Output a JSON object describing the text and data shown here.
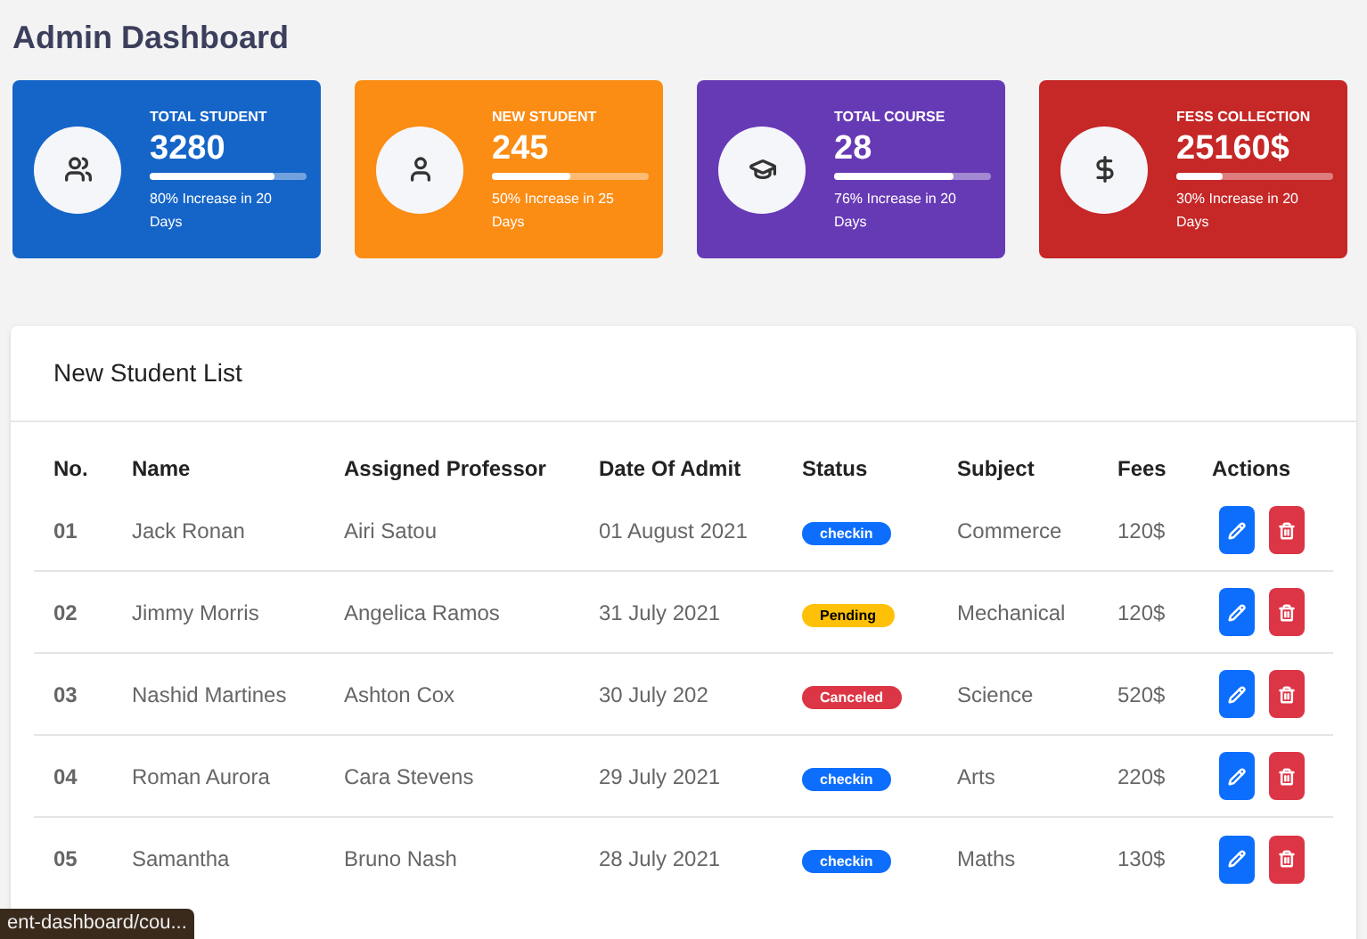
{
  "title": "Admin Dashboard",
  "cards": [
    {
      "kind": "students",
      "color": "#1565c8",
      "label": "TOTAL STUDENT",
      "value": "3280",
      "level": 0.8,
      "note": "80% Increase in 20 Days"
    },
    {
      "kind": "student",
      "color": "#fb8c14",
      "label": "NEW STUDENT",
      "value": "245",
      "level": 0.5,
      "note": "50% Increase in 25 Days"
    },
    {
      "kind": "course",
      "color": "#673ab5",
      "label": "TOTAL COURSE",
      "value": "28",
      "level": 0.76,
      "note": "76% Increase in 20 Days"
    },
    {
      "kind": "fees",
      "color": "#c62727",
      "label": "FESS COLLECTION",
      "value": "25160$",
      "level": 0.3,
      "note": "30% Increase in 20 Days"
    }
  ],
  "table": {
    "title": "New Student List",
    "columns": [
      "No.",
      "Name",
      "Assigned Professor",
      "Date Of Admit",
      "Status",
      "Subject",
      "Fees",
      "Actions"
    ],
    "rows": [
      {
        "no": "01",
        "name": "Jack Ronan",
        "professor": "Airi Satou",
        "date": "01 August 2021",
        "status": {
          "kind": "checkin",
          "label": "checkin"
        },
        "subject": "Commerce",
        "fees": "120$"
      },
      {
        "no": "02",
        "name": "Jimmy Morris",
        "professor": "Angelica Ramos",
        "date": "31 July 2021",
        "status": {
          "kind": "pending",
          "label": "Pending"
        },
        "subject": "Mechanical",
        "fees": "120$"
      },
      {
        "no": "03",
        "name": "Nashid Martines",
        "professor": "Ashton Cox",
        "date": "30 July 202",
        "status": {
          "kind": "canceled",
          "label": "Canceled"
        },
        "subject": "Science",
        "fees": "520$"
      },
      {
        "no": "04",
        "name": "Roman Aurora",
        "professor": "Cara Stevens",
        "date": "29 July 2021",
        "status": {
          "kind": "checkin",
          "label": "checkin"
        },
        "subject": "Arts",
        "fees": "220$"
      },
      {
        "no": "05",
        "name": "Samantha",
        "professor": "Bruno Nash",
        "date": "28 July 2021",
        "status": {
          "kind": "checkin",
          "label": "checkin"
        },
        "subject": "Maths",
        "fees": "130$"
      }
    ]
  },
  "status_bar": "ent-dashboard/cou..."
}
